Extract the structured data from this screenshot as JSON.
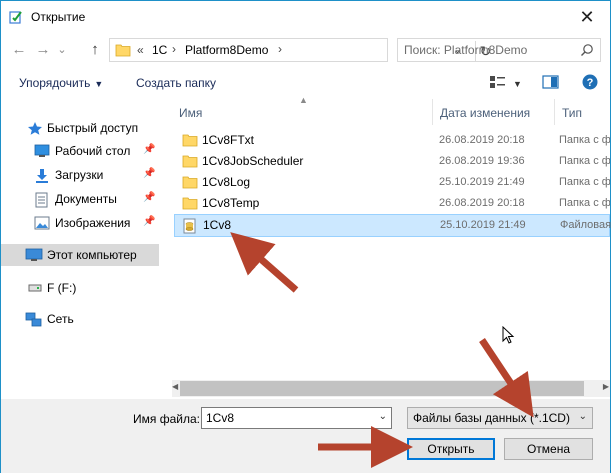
{
  "window": {
    "title": "Открытие",
    "close_glyph": "✕"
  },
  "navigation": {
    "back_glyph": "←",
    "forward_glyph": "→",
    "recent_glyph": "⌄",
    "up_glyph": "↑",
    "breadcrumb": [
      "«",
      "1C",
      "Platform8Demo"
    ],
    "crumb_separator": "›",
    "refresh_glyph": "↻",
    "search_placeholder": "Поиск: Platform8Demo"
  },
  "toolbar": {
    "organize_label": "Упорядочить",
    "new_folder_label": "Создать папку"
  },
  "sidebar": {
    "items": [
      {
        "label": "Быстрый доступ",
        "icon": "star-icon"
      },
      {
        "label": "Рабочий стол",
        "icon": "desktop-icon",
        "pinned": true
      },
      {
        "label": "Загрузки",
        "icon": "download-icon",
        "pinned": true
      },
      {
        "label": "Документы",
        "icon": "documents-icon",
        "pinned": true
      },
      {
        "label": "Изображения",
        "icon": "pictures-icon",
        "pinned": true
      },
      {
        "label": "Этот компьютер",
        "icon": "computer-icon",
        "selected": true
      },
      {
        "label": "F (F:)",
        "icon": "drive-icon"
      },
      {
        "label": "Сеть",
        "icon": "network-icon"
      }
    ],
    "pin_glyph": "📌"
  },
  "file_list": {
    "columns": [
      "Имя",
      "Дата изменения",
      "Тип"
    ],
    "rows": [
      {
        "name": "1Cv8FTxt",
        "date": "26.08.2019 20:18",
        "type": "Папка с файлами",
        "icon": "folder-icon"
      },
      {
        "name": "1Cv8JobScheduler",
        "date": "26.08.2019 19:36",
        "type": "Папка с файлами",
        "icon": "folder-icon"
      },
      {
        "name": "1Cv8Log",
        "date": "25.10.2019 21:49",
        "type": "Папка с файлами",
        "icon": "folder-icon"
      },
      {
        "name": "1Cv8Temp",
        "date": "26.08.2019 20:18",
        "type": "Папка с файлами",
        "icon": "folder-icon"
      },
      {
        "name": "1Cv8",
        "date": "25.10.2019 21:49",
        "type": "Файловая база",
        "icon": "database-file-icon",
        "selected": true
      }
    ]
  },
  "bottom": {
    "filename_label": "Имя файла:",
    "filename_value": "1Cv8",
    "filter_value": "Файлы базы данных (*.1CD)",
    "open_label": "Открыть",
    "cancel_label": "Отмена"
  },
  "colors": {
    "accent": "#0078d7",
    "selection": "#cce8ff",
    "annotation_arrow": "#b5432d",
    "folder": "#ffd767"
  }
}
